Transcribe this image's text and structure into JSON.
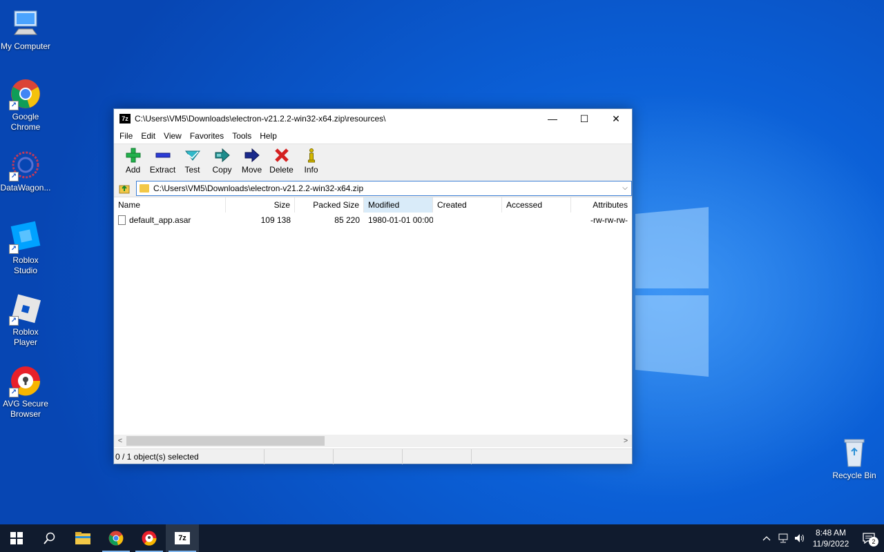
{
  "desktop": {
    "icons": [
      {
        "label": "My Computer",
        "icon": "computer-icon"
      },
      {
        "label": "Google Chrome",
        "icon": "chrome-icon"
      },
      {
        "label": "DataWagon...",
        "icon": "datawagon-icon"
      },
      {
        "label": "Roblox Studio",
        "icon": "roblox-studio-icon"
      },
      {
        "label": "Roblox Player",
        "icon": "roblox-player-icon"
      },
      {
        "label": "AVG Secure Browser",
        "icon": "avg-browser-icon"
      },
      {
        "label": "Recycle Bin",
        "icon": "recycle-bin-icon"
      }
    ]
  },
  "window": {
    "app_icon_text": "7z",
    "title": "C:\\Users\\VM5\\Downloads\\electron-v21.2.2-win32-x64.zip\\resources\\",
    "controls": {
      "minimize": "—",
      "maximize": "☐",
      "close": "✕"
    },
    "menu": [
      "File",
      "Edit",
      "View",
      "Favorites",
      "Tools",
      "Help"
    ],
    "toolbar": [
      {
        "label": "Add",
        "icon": "add-icon",
        "color": "#22b14c"
      },
      {
        "label": "Extract",
        "icon": "extract-icon",
        "color": "#2b3bd6"
      },
      {
        "label": "Test",
        "icon": "test-icon",
        "color": "#30b8c8"
      },
      {
        "label": "Copy",
        "icon": "copy-icon",
        "color": "#1f8c8c"
      },
      {
        "label": "Move",
        "icon": "move-icon",
        "color": "#1a2a8c"
      },
      {
        "label": "Delete",
        "icon": "delete-icon",
        "color": "#d42020"
      },
      {
        "label": "Info",
        "icon": "info-icon",
        "color": "#d4b800"
      }
    ],
    "address": "C:\\Users\\VM5\\Downloads\\electron-v21.2.2-win32-x64.zip",
    "columns": [
      "Name",
      "Size",
      "Packed Size",
      "Modified",
      "Created",
      "Accessed",
      "Attributes"
    ],
    "sorted_column": "Modified",
    "rows": [
      {
        "name": "default_app.asar",
        "size": "109 138",
        "packed": "85 220",
        "modified": "1980-01-01 00:00",
        "created": "",
        "accessed": "",
        "attributes": "-rw-rw-rw-"
      }
    ],
    "status": [
      "0 / 1 object(s) selected",
      "",
      "",
      ""
    ]
  },
  "taskbar": {
    "apps": [
      {
        "name": "start",
        "icon": "windows-start-icon"
      },
      {
        "name": "search",
        "icon": "search-icon"
      },
      {
        "name": "file-explorer",
        "icon": "folder-icon"
      },
      {
        "name": "chrome",
        "icon": "chrome-icon"
      },
      {
        "name": "avg",
        "icon": "avg-browser-icon"
      },
      {
        "name": "7zip",
        "icon": "7zip-icon"
      }
    ],
    "time": "8:48 AM",
    "date": "11/9/2022",
    "notification_count": "2"
  },
  "colors": {
    "accent": "#0a54c7",
    "window_border": "#5a7fb0",
    "taskbar": "#101b2e"
  }
}
